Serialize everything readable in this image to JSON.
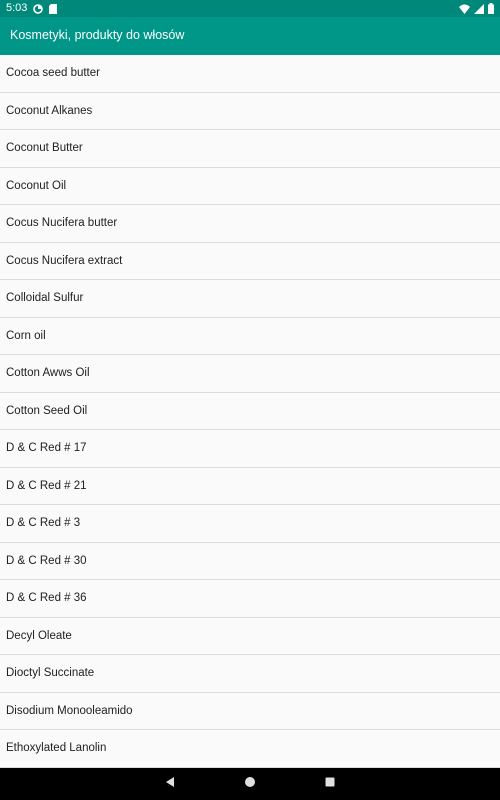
{
  "status_bar": {
    "time": "5:03",
    "icons": [
      "data-saver-icon",
      "sd-card-icon",
      "wifi-icon",
      "signal-icon",
      "battery-icon"
    ]
  },
  "app_bar": {
    "title": "Kosmetyki, produkty do włosów"
  },
  "list": {
    "items": [
      {
        "label": "Cocoa seed butter"
      },
      {
        "label": "Coconut Alkanes"
      },
      {
        "label": "Coconut Butter"
      },
      {
        "label": "Coconut Oil"
      },
      {
        "label": "Cocus Nucifera butter"
      },
      {
        "label": "Cocus Nucifera extract"
      },
      {
        "label": "Colloidal Sulfur"
      },
      {
        "label": "Corn oil"
      },
      {
        "label": "Cotton Awws Oil"
      },
      {
        "label": "Cotton Seed Oil"
      },
      {
        "label": "D & C Red # 17"
      },
      {
        "label": "D & C Red # 21"
      },
      {
        "label": "D & C Red # 3"
      },
      {
        "label": "D & C Red # 30"
      },
      {
        "label": "D & C Red # 36"
      },
      {
        "label": "Decyl Oleate"
      },
      {
        "label": "Dioctyl Succinate"
      },
      {
        "label": "Disodium Monooleamido"
      },
      {
        "label": "Ethoxylated Lanolin"
      }
    ]
  },
  "nav_bar": {
    "buttons": [
      "back-icon",
      "home-icon",
      "recents-icon"
    ]
  },
  "colors": {
    "app_bar": "#009688",
    "status_bar": "#00897b",
    "list_background": "#fafafa",
    "divider": "#dcdcdc",
    "text": "#212121",
    "nav_bar": "#000000"
  }
}
